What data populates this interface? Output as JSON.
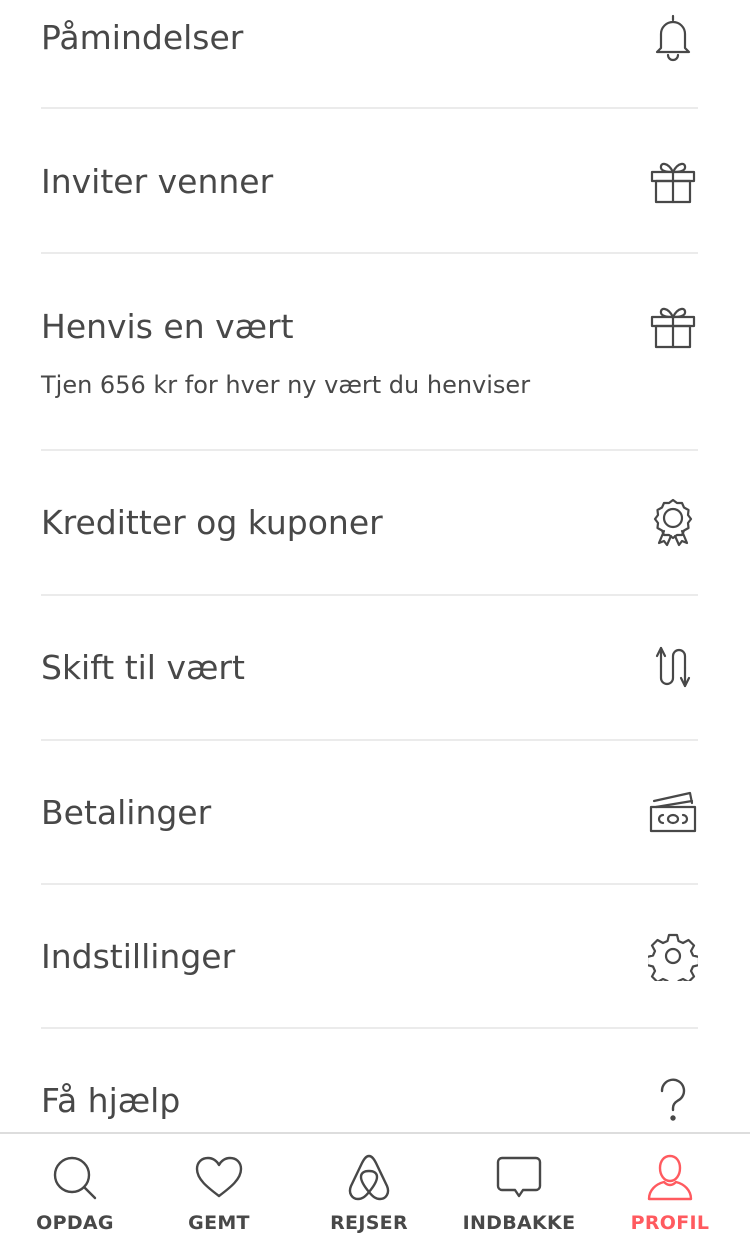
{
  "menu": {
    "items": [
      {
        "label": "Påmindelser",
        "icon": "bell-icon"
      },
      {
        "label": "Inviter venner",
        "icon": "gift-icon"
      },
      {
        "label": "Henvis en vært",
        "sublabel": "Tjen 656 kr for hver ny vært du henviser",
        "icon": "gift-icon"
      },
      {
        "label": "Kreditter og kuponer",
        "icon": "award-ribbon-icon"
      },
      {
        "label": "Skift til vært",
        "icon": "switch-arrows-icon"
      },
      {
        "label": "Betalinger",
        "icon": "cash-icon"
      },
      {
        "label": "Indstillinger",
        "icon": "gear-icon"
      },
      {
        "label": "Få hjælp",
        "icon": "question-icon"
      }
    ]
  },
  "tabbar": {
    "tabs": [
      {
        "label": "OPDAG",
        "icon": "search-icon",
        "active": false
      },
      {
        "label": "GEMT",
        "icon": "heart-icon",
        "active": false
      },
      {
        "label": "REJSER",
        "icon": "airbnb-logo-icon",
        "active": false
      },
      {
        "label": "INDBAKKE",
        "icon": "chat-bubble-icon",
        "active": false
      },
      {
        "label": "PROFIL",
        "icon": "user-icon",
        "active": true
      }
    ]
  },
  "colors": {
    "text": "#484848",
    "accent": "#ff5a5f",
    "divider": "#ebebeb"
  }
}
